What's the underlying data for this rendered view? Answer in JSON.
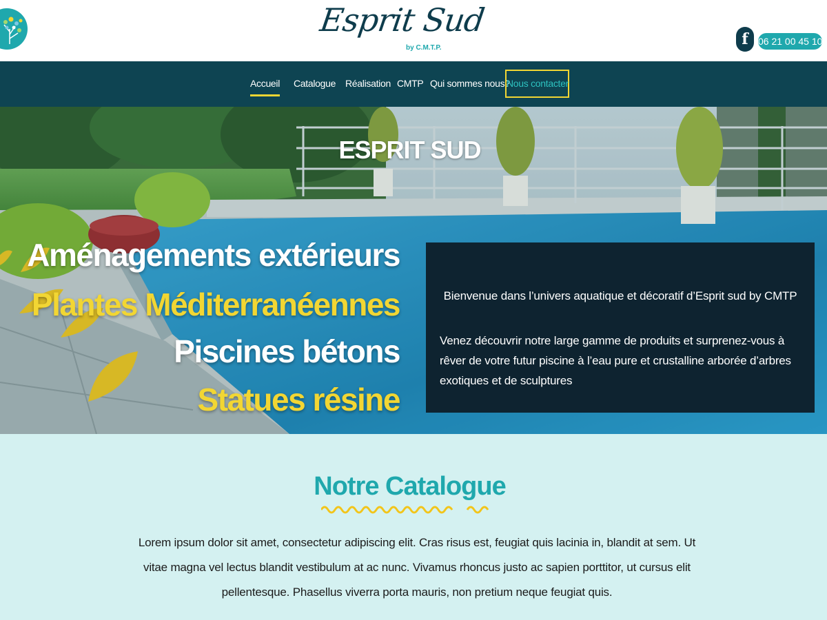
{
  "header": {
    "brand_name": "Esprit Sud",
    "brand_sub": "by C.M.T.P.",
    "facebook_letter": "f",
    "phone": "06 21 00 45 10"
  },
  "nav": {
    "items": [
      {
        "label": "Accueil",
        "active": true
      },
      {
        "label": "Catalogue"
      },
      {
        "label": "Réalisation"
      },
      {
        "label": "CMTP"
      },
      {
        "label": "Qui sommes nous?"
      }
    ],
    "contact_label": "Nous contacter"
  },
  "hero": {
    "title": "ESPRIT SUD",
    "lines": [
      "Aménagements extérieurs",
      "Plantes Méditerranéennes",
      "Piscines bétons",
      "Statues résine"
    ],
    "welcome": "Bienvenue dans l’univers aquatique et décoratif d’Esprit sud by CMTP",
    "description": "Venez découvrir notre large gamme de produits et surprenez-vous à rêver de votre futur piscine à l’eau pure et crustalline arborée d’arbres exotiques et de sculptures"
  },
  "catalogue": {
    "title": "Notre Catalogue",
    "text": "Lorem ipsum dolor sit amet, consectetur adipiscing elit. Cras risus est, feugiat quis lacinia in, blandit at sem. Ut vitae magna vel lectus blandit vestibulum at ac nunc. Vivamus rhoncus justo ac sapien porttitor, ut cursus elit pellentesque. Phasellus viverra porta mauris, non pretium neque feugiat quis."
  },
  "colors": {
    "teal": "#1fa8ad",
    "navy": "#0e4452",
    "yellow": "#f2d633",
    "dark_box": "#0e2330",
    "light_bg": "#d4f1f1"
  },
  "icons": [
    "tree-logo-icon",
    "facebook-icon",
    "leaf-icon",
    "wave-underline-icon"
  ]
}
